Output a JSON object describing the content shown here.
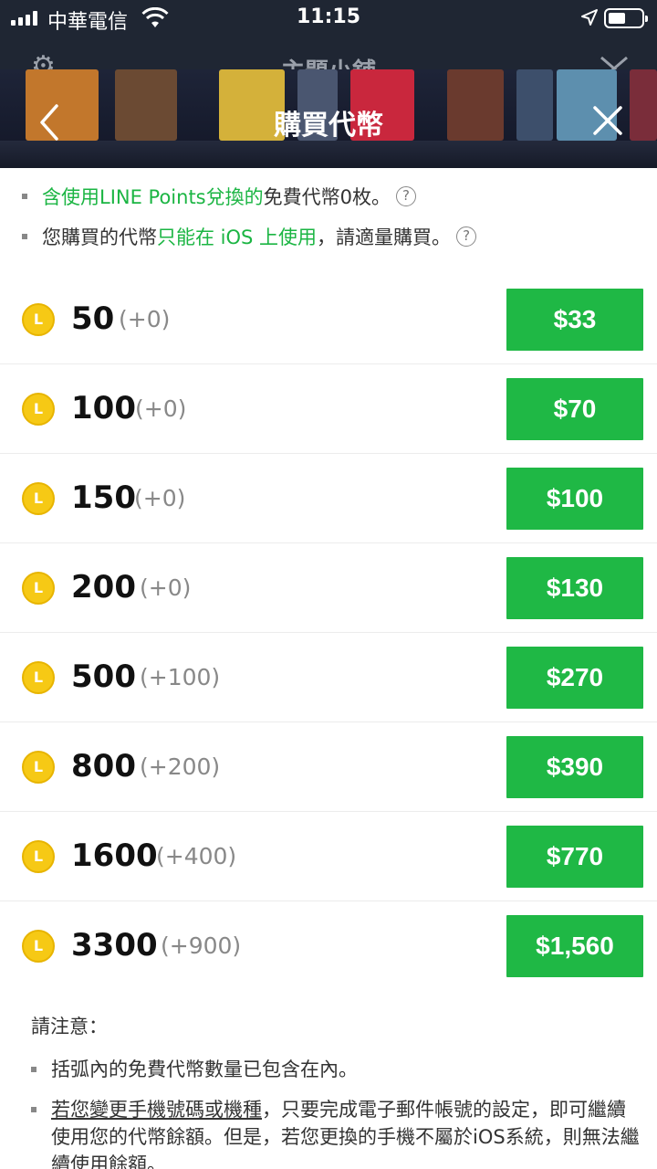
{
  "status_bar": {
    "carrier": "中華電信",
    "time": "11:15"
  },
  "header": {
    "background_title": "主題小舖",
    "title": "購買代幣"
  },
  "notes_top": {
    "line1_green": "含使用LINE Points兌換的",
    "line1_rest": "免費代幣0枚。",
    "line2_start": "您購買的代幣",
    "line2_green": "只能在 iOS 上使用",
    "line2_end": "，請適量購買。",
    "help_symbol": "?"
  },
  "coin_symbol": "L",
  "coin_packages": [
    {
      "amount": "50",
      "bonus": "(+0)",
      "price": "$33"
    },
    {
      "amount": "100",
      "bonus": "(+0)",
      "price": "$70"
    },
    {
      "amount": "150",
      "bonus": "(+0)",
      "price": "$100"
    },
    {
      "amount": "200",
      "bonus": "(+0)",
      "price": "$130"
    },
    {
      "amount": "500",
      "bonus": "(+100)",
      "price": "$270"
    },
    {
      "amount": "800",
      "bonus": "(+200)",
      "price": "$390"
    },
    {
      "amount": "1600",
      "bonus": "(+400)",
      "price": "$770"
    },
    {
      "amount": "3300",
      "bonus": "(+900)",
      "price": "$1,560"
    }
  ],
  "notes_bottom": {
    "heading": "請注意：",
    "item1": "括弧內的免費代幣數量已包含在內。",
    "item2_underlined": "若您變更手機號碼或機種",
    "item2_rest": "，只要完成電子郵件帳號的設定，即可繼續使用您的代幣餘額。但是，若您更換的手機不屬於iOS系統，則無法繼續使用餘額。"
  },
  "colors": {
    "accent_green": "#1fb845",
    "coin_yellow": "#f6c915",
    "header_dark": "#1f2633"
  }
}
